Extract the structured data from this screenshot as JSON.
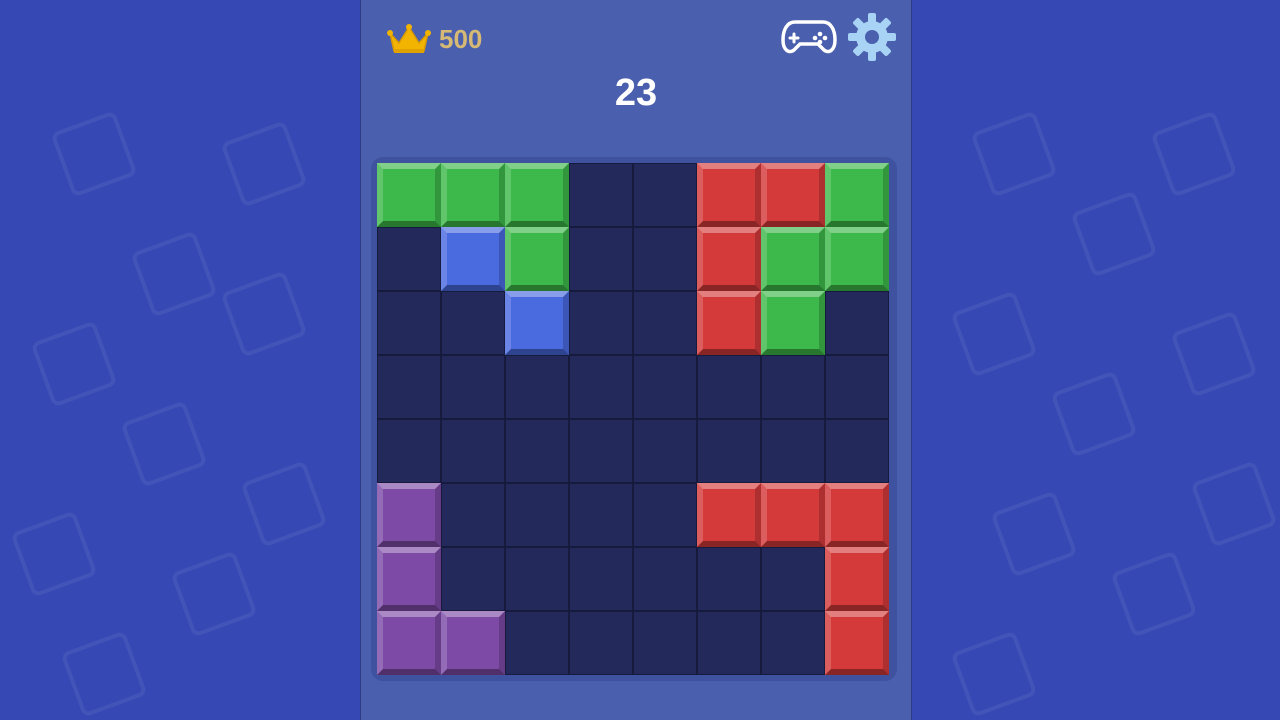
{
  "header": {
    "best_score": "500",
    "current_score": "23",
    "icons": {
      "best": "crown-icon",
      "games": "gamepad-icon",
      "settings": "gear-icon"
    }
  },
  "colors": {
    "green": "#3db84a",
    "blue": "#4a6ae0",
    "red": "#d43a3a",
    "purple": "#7d4aa6",
    "empty": "#23295a",
    "crown": "#f2b400"
  },
  "board": {
    "rows": 8,
    "cols": 8,
    "cells": [
      [
        "green",
        "green",
        "green",
        null,
        null,
        "red",
        "red",
        "green"
      ],
      [
        null,
        "blue",
        "green",
        null,
        null,
        "red",
        "green",
        "green"
      ],
      [
        null,
        null,
        "blue",
        null,
        null,
        "red",
        "green",
        null
      ],
      [
        null,
        null,
        null,
        null,
        null,
        null,
        null,
        null
      ],
      [
        null,
        null,
        null,
        null,
        null,
        null,
        null,
        null
      ],
      [
        "purple",
        null,
        null,
        null,
        null,
        "red",
        "red",
        "red"
      ],
      [
        "purple",
        null,
        null,
        null,
        null,
        null,
        null,
        "red"
      ],
      [
        "purple",
        "purple",
        null,
        null,
        null,
        null,
        null,
        "red"
      ]
    ]
  }
}
